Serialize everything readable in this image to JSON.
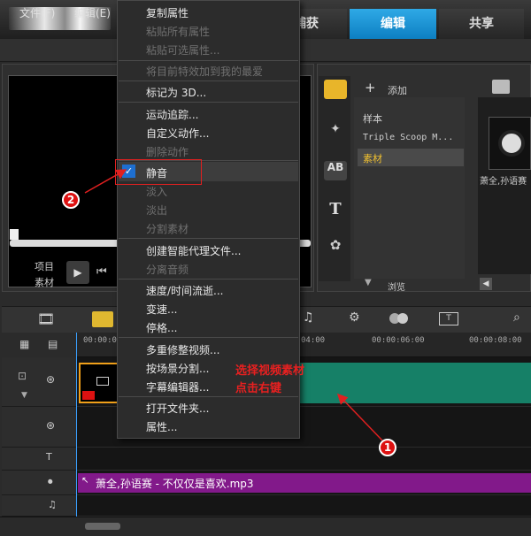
{
  "tabs": {
    "capture": "捕获",
    "edit": "编辑",
    "share": "共享"
  },
  "menubar": {
    "file": "文件(F)",
    "edit": "编辑(E)"
  },
  "preview": {
    "project_label": "项目",
    "clip_label": "素材"
  },
  "library": {
    "add_label": "添加",
    "items": [
      "样本",
      "Triple Scoop M...",
      "素材"
    ],
    "thumb_caption": "萧全,孙语赛",
    "bottom_label": "浏览"
  },
  "timeline": {
    "ticks": [
      "00:00:00",
      "00:00:04:00",
      "00:00:06:00",
      "00:00:08:00"
    ],
    "audio_clip": "萧全,孙语赛 - 不仅仅是喜欢.mp3"
  },
  "context_menu": {
    "items": [
      {
        "label": "复制属性",
        "disabled": false
      },
      {
        "label": "粘贴所有属性",
        "disabled": true
      },
      {
        "label": "粘贴可选属性...",
        "disabled": true
      },
      {
        "label": "将目前特效加到我的最爱",
        "disabled": true
      },
      {
        "label": "标记为 3D...",
        "disabled": false
      },
      {
        "label": "运动追踪...",
        "disabled": false
      },
      {
        "label": "自定义动作...",
        "disabled": false
      },
      {
        "label": "删除动作",
        "disabled": true
      },
      {
        "label": "静音",
        "disabled": false,
        "checked": true
      },
      {
        "label": "淡入",
        "disabled": true
      },
      {
        "label": "淡出",
        "disabled": true
      },
      {
        "label": "分割素材",
        "disabled": true
      },
      {
        "label": "创建智能代理文件...",
        "disabled": false
      },
      {
        "label": "分离音频",
        "disabled": true
      },
      {
        "label": "速度/时间流逝...",
        "disabled": false
      },
      {
        "label": "变速...",
        "disabled": false
      },
      {
        "label": "停格...",
        "disabled": false
      },
      {
        "label": "多重修整视频...",
        "disabled": false
      },
      {
        "label": "按场景分割...",
        "disabled": false
      },
      {
        "label": "字幕编辑器...",
        "disabled": false
      },
      {
        "label": "打开文件夹...",
        "disabled": false
      },
      {
        "label": "属性...",
        "disabled": false
      }
    ]
  },
  "annotations": {
    "badge1": "1",
    "badge2": "2",
    "text_line1": "选择视频素材",
    "text_line2": "点击右键"
  },
  "colors": {
    "accent": "#1a8fd6",
    "video_clip": "#168067",
    "audio_clip": "#82198a",
    "annotation": "#e02020"
  }
}
